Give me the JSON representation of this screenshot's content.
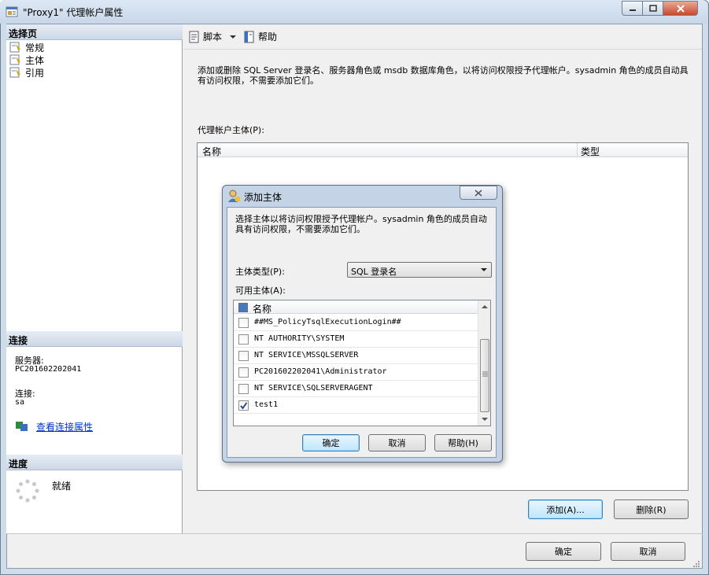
{
  "window": {
    "title": "\"Proxy1\" 代理帐户属性"
  },
  "left_pane": {
    "select_page_header": "选择页",
    "nav_items": [
      {
        "label": "常规"
      },
      {
        "label": "主体"
      },
      {
        "label": "引用"
      }
    ],
    "connection_header": "连接",
    "server_label": "服务器:",
    "server_value": "PC201602202041",
    "connection_label": "连接:",
    "connection_value": "sa",
    "view_connection_link": "查看连接属性",
    "progress_header": "进度",
    "progress_status": "就绪"
  },
  "toolbar": {
    "script_label": "脚本",
    "help_label": "帮助"
  },
  "main": {
    "description": "添加或删除 SQL Server 登录名、服务器角色或 msdb 数据库角色，以将访问权限授予代理帐户。sysadmin 角色的成员自动具有访问权限，不需要添加它们。",
    "principals_label": "代理帐户主体(P):",
    "columns": [
      "名称",
      "类型"
    ],
    "add_button": "添加(A)...",
    "remove_button": "删除(R)",
    "ok_button": "确定",
    "cancel_button": "取消"
  },
  "dialog": {
    "title": "添加主体",
    "description": "选择主体以将访问权限授予代理帐户。sysadmin 角色的成员自动具有访问权限，不需要添加它们。",
    "principal_type_label": "主体类型(P):",
    "principal_type_value": "SQL 登录名",
    "available_label": "可用主体(A):",
    "name_column": "名称",
    "rows": [
      {
        "name": "##MS_PolicyTsqlExecutionLogin##",
        "checked": false
      },
      {
        "name": "NT AUTHORITY\\SYSTEM",
        "checked": false
      },
      {
        "name": "NT SERVICE\\MSSQLSERVER",
        "checked": false
      },
      {
        "name": "PC201602202041\\Administrator",
        "checked": false
      },
      {
        "name": "NT SERVICE\\SQLSERVERAGENT",
        "checked": false
      },
      {
        "name": "test1",
        "checked": true
      }
    ],
    "ok_button": "确定",
    "cancel_button": "取消",
    "help_button": "帮助(H)"
  },
  "colors": {
    "title_bar": "#c8d7e9",
    "link": "#0033cc",
    "default_button": "#bee6fd"
  }
}
